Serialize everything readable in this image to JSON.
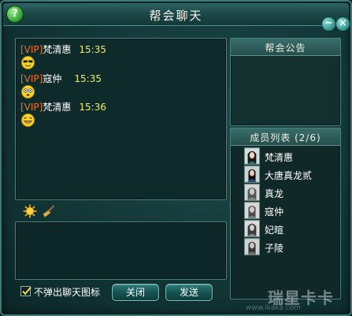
{
  "window": {
    "title": "帮会聊天"
  },
  "chat": {
    "messages": [
      {
        "vip": "[VIP]",
        "name": "梵清惠",
        "time": "15:35"
      },
      {
        "vip": "[VIP]",
        "name": "寇仲",
        "time": "15:35"
      },
      {
        "vip": "[VIP]",
        "name": "梵清惠",
        "time": "15:36"
      }
    ]
  },
  "input": {
    "value": ""
  },
  "options": {
    "no_popup_label": "不弹出聊天图标",
    "no_popup_checked": true
  },
  "buttons": {
    "close_label": "关闭",
    "send_label": "发送"
  },
  "notice": {
    "title": "帮会公告",
    "content": ""
  },
  "members": {
    "title": "成员列表 (2/6)",
    "list": [
      {
        "name": "梵清惠",
        "online": true
      },
      {
        "name": "大唐真龙贰",
        "online": true
      },
      {
        "name": "真龙",
        "online": false
      },
      {
        "name": "寇仲",
        "online": false
      },
      {
        "name": "妃暄",
        "online": false
      },
      {
        "name": "子陵",
        "online": false
      }
    ]
  },
  "watermark": {
    "logo": "瑞星卡卡",
    "url": "www.ikaka.com"
  },
  "colors": {
    "vip": "#f07020",
    "time": "#f2ee5a",
    "name": "#ffffff"
  }
}
